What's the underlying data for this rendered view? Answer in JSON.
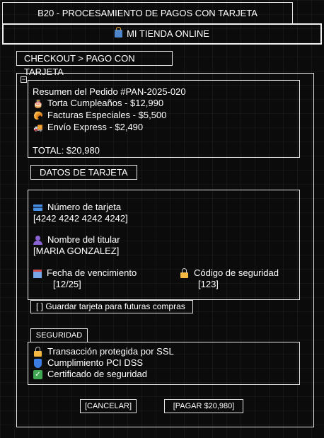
{
  "window": {
    "title": "B20 - PROCESAMIENTO DE PAGOS CON TARJETA"
  },
  "store": {
    "icon": "shopping-bags-icon",
    "name": "MI TIENDA ONLINE"
  },
  "breadcrumb": "CHECKOUT > PAGO CON TARJETA",
  "collapse_glyph": "−",
  "order": {
    "title": "Resumen del Pedido #PAN-2025-020",
    "items": [
      {
        "icon": "cake-icon",
        "glyph": "🎂",
        "label": "Torta Cumpleaños - $12,990"
      },
      {
        "icon": "croissant-icon",
        "glyph": "🥐",
        "label": "Facturas Especiales - $5,500"
      },
      {
        "icon": "truck-icon",
        "glyph": "🚚",
        "label": "Envío Express - $2,490"
      }
    ],
    "total": "TOTAL: $20,980"
  },
  "card_section_title": "DATOS DE TARJETA",
  "card": {
    "number_label": "Número de tarjeta",
    "number_value": "[4242 4242 4242 4242]",
    "holder_label": "Nombre del titular",
    "holder_value": "[MARIA GONZALEZ]",
    "expiry_label": "Fecha de vencimiento",
    "expiry_value": "[12/25]",
    "cvv_label": "Código de seguridad",
    "cvv_value": "[123]"
  },
  "save_card": "[ ] Guardar tarjeta para futuras compras",
  "security": {
    "tab": "SEGURIDAD",
    "items": [
      {
        "icon": "lock-icon",
        "label": "Transacción protegida por SSL"
      },
      {
        "icon": "shield-icon",
        "label": "Cumplimiento PCI DSS"
      },
      {
        "icon": "checkmark-icon",
        "label": "Certificado de seguridad"
      }
    ]
  },
  "actions": {
    "cancel": "[CANCELAR]",
    "pay": "[PAGAR $20,980]"
  },
  "colors": {
    "background": "#0b0b0b",
    "foreground": "#ffffff",
    "border": "#e6e6e6"
  }
}
